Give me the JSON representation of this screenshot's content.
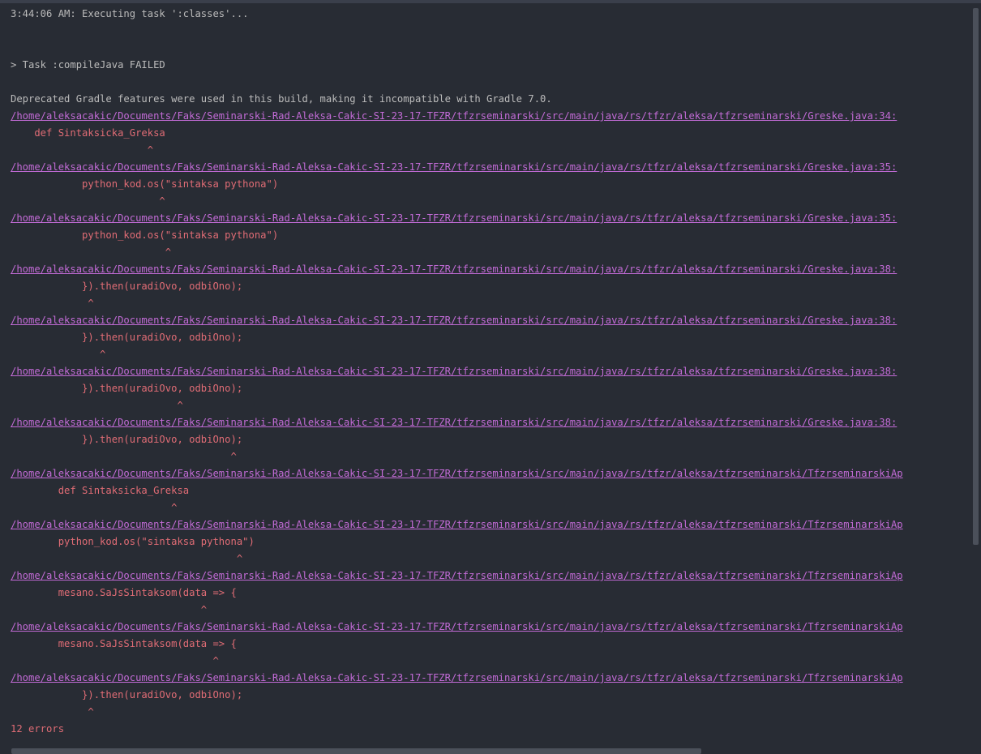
{
  "console": {
    "lines": [
      {
        "text": "3:44:06 AM: Executing task ':classes'...",
        "kind": "plain"
      },
      {
        "text": "",
        "kind": "plain"
      },
      {
        "text": "",
        "kind": "plain"
      },
      {
        "text": "> Task :compileJava FAILED",
        "kind": "plain"
      },
      {
        "text": "",
        "kind": "plain"
      },
      {
        "text": "Deprecated Gradle features were used in this build, making it incompatible with Gradle 7.0.",
        "kind": "plain"
      },
      {
        "text": "/home/aleksacakic/Documents/Faks/Seminarski-Rad-Aleksa-Cakic-SI-23-17-TFZR/tfzrseminarski/src/main/java/rs/tfzr/aleksa/tfzrseminarski/Greske.java:34:",
        "kind": "link"
      },
      {
        "text": "    def Sintaksicka_Greksa",
        "kind": "error"
      },
      {
        "text": "                       ^",
        "kind": "error"
      },
      {
        "text": "/home/aleksacakic/Documents/Faks/Seminarski-Rad-Aleksa-Cakic-SI-23-17-TFZR/tfzrseminarski/src/main/java/rs/tfzr/aleksa/tfzrseminarski/Greske.java:35:",
        "kind": "link"
      },
      {
        "text": "            python_kod.os(\"sintaksa pythona\")",
        "kind": "error"
      },
      {
        "text": "                         ^",
        "kind": "error"
      },
      {
        "text": "/home/aleksacakic/Documents/Faks/Seminarski-Rad-Aleksa-Cakic-SI-23-17-TFZR/tfzrseminarski/src/main/java/rs/tfzr/aleksa/tfzrseminarski/Greske.java:35:",
        "kind": "link"
      },
      {
        "text": "            python_kod.os(\"sintaksa pythona\")",
        "kind": "error"
      },
      {
        "text": "                          ^",
        "kind": "error"
      },
      {
        "text": "/home/aleksacakic/Documents/Faks/Seminarski-Rad-Aleksa-Cakic-SI-23-17-TFZR/tfzrseminarski/src/main/java/rs/tfzr/aleksa/tfzrseminarski/Greske.java:38:",
        "kind": "link"
      },
      {
        "text": "            }).then(uradiOvo, odbiOno);",
        "kind": "error"
      },
      {
        "text": "             ^",
        "kind": "error"
      },
      {
        "text": "/home/aleksacakic/Documents/Faks/Seminarski-Rad-Aleksa-Cakic-SI-23-17-TFZR/tfzrseminarski/src/main/java/rs/tfzr/aleksa/tfzrseminarski/Greske.java:38:",
        "kind": "link"
      },
      {
        "text": "            }).then(uradiOvo, odbiOno);",
        "kind": "error"
      },
      {
        "text": "               ^",
        "kind": "error"
      },
      {
        "text": "/home/aleksacakic/Documents/Faks/Seminarski-Rad-Aleksa-Cakic-SI-23-17-TFZR/tfzrseminarski/src/main/java/rs/tfzr/aleksa/tfzrseminarski/Greske.java:38:",
        "kind": "link"
      },
      {
        "text": "            }).then(uradiOvo, odbiOno);",
        "kind": "error"
      },
      {
        "text": "                            ^",
        "kind": "error"
      },
      {
        "text": "/home/aleksacakic/Documents/Faks/Seminarski-Rad-Aleksa-Cakic-SI-23-17-TFZR/tfzrseminarski/src/main/java/rs/tfzr/aleksa/tfzrseminarski/Greske.java:38:",
        "kind": "link"
      },
      {
        "text": "            }).then(uradiOvo, odbiOno);",
        "kind": "error"
      },
      {
        "text": "                                     ^",
        "kind": "error"
      },
      {
        "text": "/home/aleksacakic/Documents/Faks/Seminarski-Rad-Aleksa-Cakic-SI-23-17-TFZR/tfzrseminarski/src/main/java/rs/tfzr/aleksa/tfzrseminarski/TfzrseminarskiAp",
        "kind": "link"
      },
      {
        "text": "        def Sintaksicka_Greksa",
        "kind": "error"
      },
      {
        "text": "                           ^",
        "kind": "error"
      },
      {
        "text": "/home/aleksacakic/Documents/Faks/Seminarski-Rad-Aleksa-Cakic-SI-23-17-TFZR/tfzrseminarski/src/main/java/rs/tfzr/aleksa/tfzrseminarski/TfzrseminarskiAp",
        "kind": "link"
      },
      {
        "text": "        python_kod.os(\"sintaksa pythona\")",
        "kind": "error"
      },
      {
        "text": "                                      ^",
        "kind": "error"
      },
      {
        "text": "/home/aleksacakic/Documents/Faks/Seminarski-Rad-Aleksa-Cakic-SI-23-17-TFZR/tfzrseminarski/src/main/java/rs/tfzr/aleksa/tfzrseminarski/TfzrseminarskiAp",
        "kind": "link"
      },
      {
        "text": "        mesano.SaJsSintaksom(data => {",
        "kind": "error"
      },
      {
        "text": "                                ^",
        "kind": "error"
      },
      {
        "text": "/home/aleksacakic/Documents/Faks/Seminarski-Rad-Aleksa-Cakic-SI-23-17-TFZR/tfzrseminarski/src/main/java/rs/tfzr/aleksa/tfzrseminarski/TfzrseminarskiAp",
        "kind": "link"
      },
      {
        "text": "        mesano.SaJsSintaksom(data => {",
        "kind": "error"
      },
      {
        "text": "                                  ^",
        "kind": "error"
      },
      {
        "text": "/home/aleksacakic/Documents/Faks/Seminarski-Rad-Aleksa-Cakic-SI-23-17-TFZR/tfzrseminarski/src/main/java/rs/tfzr/aleksa/tfzrseminarski/TfzrseminarskiAp",
        "kind": "link"
      },
      {
        "text": "            }).then(uradiOvo, odbiOno);",
        "kind": "error"
      },
      {
        "text": "             ^",
        "kind": "error"
      },
      {
        "text": "12 errors",
        "kind": "error"
      }
    ]
  },
  "colors": {
    "background": "#282c34",
    "plain_text": "#bbbbbb",
    "error_text": "#e06c75",
    "link_text": "#c26bd6"
  }
}
